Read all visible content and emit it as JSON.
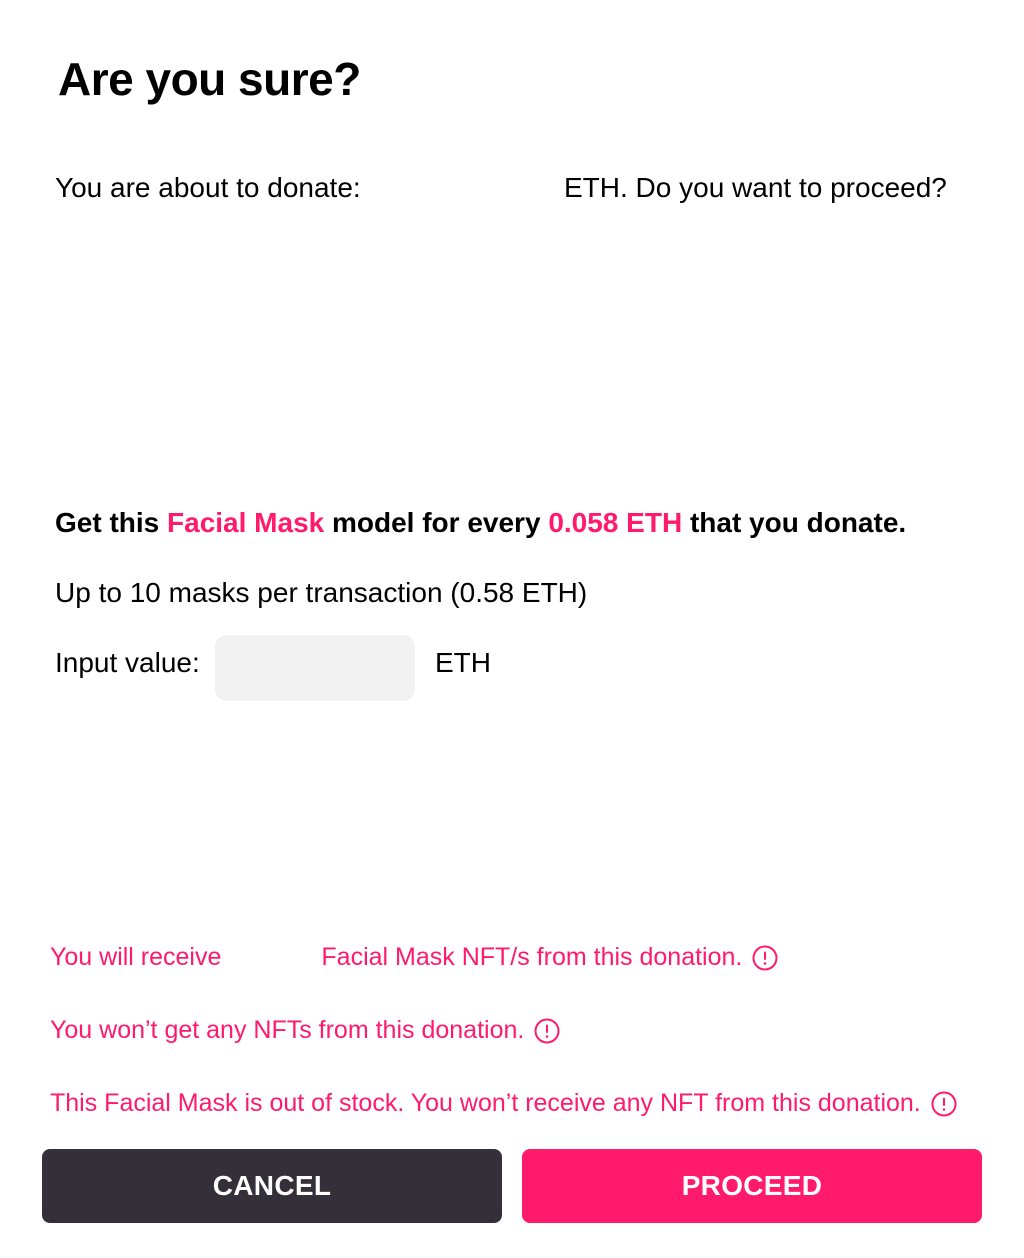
{
  "dialog": {
    "title": "Are you sure?",
    "confirm_prefix": "You are about to donate:",
    "confirm_amount": "",
    "confirm_suffix": "ETH. Do you want to proceed?"
  },
  "offer": {
    "part1": "Get this ",
    "product": "Facial Mask",
    "part2": " model for every ",
    "price": "0.058 ETH",
    "part3": " that you donate."
  },
  "limit_text": "Up to 10 masks per transaction (0.58 ETH)",
  "input": {
    "label": "Input value:",
    "value": "",
    "placeholder": "",
    "unit": "ETH"
  },
  "notices": {
    "receive_prefix": "You will receive",
    "receive_count": "",
    "receive_suffix": "Facial Mask NFT/s from this donation.",
    "no_nft": "You won’t get any NFTs from this donation.",
    "out_of_stock": "This Facial Mask is out of stock. You won’t receive any NFT from this donation."
  },
  "icons": {
    "info": "exclamation-circle-icon"
  },
  "buttons": {
    "cancel": "CANCEL",
    "proceed": "PROCEED"
  },
  "colors": {
    "accent": "#ff1a6c",
    "cancel_bg": "#34303a",
    "input_bg": "#f2f2f2"
  }
}
